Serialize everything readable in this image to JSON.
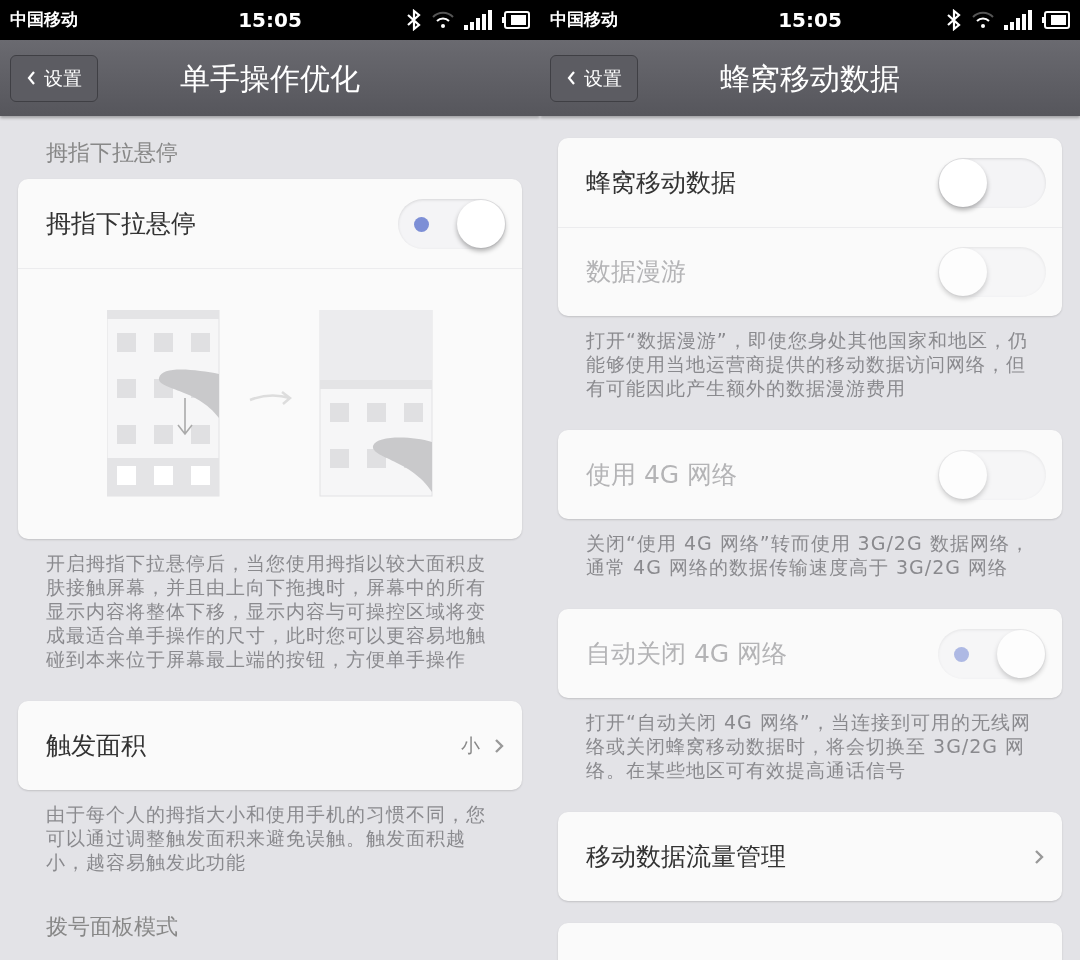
{
  "screens": [
    {
      "status_bar": {
        "carrier": "中国移动",
        "time": "15:05"
      },
      "nav": {
        "back": "设置",
        "title": "单手操作优化"
      },
      "items": [
        {
          "kind": "header",
          "text": "拇指下拉悬停"
        },
        {
          "kind": "card",
          "rows": [
            {
              "kind": "toggle",
              "label": "拇指下拉悬停",
              "on": true,
              "disabled": false
            },
            {
              "kind": "illustration"
            }
          ]
        },
        {
          "kind": "note",
          "text": "开启拇指下拉悬停后，当您使用拇指以较大面积皮肤接触屏幕，并且由上向下拖拽时，屏幕中的所有显示内容将整体下移，显示内容与可操控区域将变成最适合单手操作的尺寸，此时您可以更容易地触碰到本来位于屏幕最上端的按钮，方便单手操作"
        },
        {
          "kind": "card",
          "rows": [
            {
              "kind": "link",
              "label": "触发面积",
              "value": "小"
            }
          ]
        },
        {
          "kind": "note",
          "text": "由于每个人的拇指大小和使用手机的习惯不同，您可以通过调整触发面积来避免误触。触发面积越小，越容易触发此功能"
        },
        {
          "kind": "header",
          "text": "拨号面板模式"
        }
      ]
    },
    {
      "status_bar": {
        "carrier": "中国移动",
        "time": "15:05"
      },
      "nav": {
        "back": "设置",
        "title": "蜂窝移动数据"
      },
      "items": [
        {
          "kind": "card",
          "rows": [
            {
              "kind": "toggle",
              "label": "蜂窝移动数据",
              "on": false,
              "disabled": false
            },
            {
              "kind": "toggle",
              "label": "数据漫游",
              "on": false,
              "disabled": true
            }
          ]
        },
        {
          "kind": "note",
          "text": "打开“数据漫游”，即使您身处其他国家和地区，仍能够使用当地运营商提供的移动数据访问网络，但有可能因此产生额外的数据漫游费用"
        },
        {
          "kind": "card",
          "rows": [
            {
              "kind": "toggle",
              "label": "使用 4G 网络",
              "on": false,
              "disabled": true
            }
          ]
        },
        {
          "kind": "note",
          "text": "关闭“使用 4G 网络”转而使用 3G/2G 数据网络，通常 4G 网络的数据传输速度高于 3G/2G 网络"
        },
        {
          "kind": "card",
          "rows": [
            {
              "kind": "toggle",
              "label": "自动关闭 4G 网络",
              "on": true,
              "disabled": true
            }
          ]
        },
        {
          "kind": "note",
          "text": "打开“自动关闭 4G 网络”，当连接到可用的无线网络或关闭蜂窝移动数据时，将会切换至 3G/2G 网络。在某些地区可有效提高通话信号"
        },
        {
          "kind": "card",
          "rows": [
            {
              "kind": "link",
              "label": "移动数据流量管理"
            }
          ]
        },
        {
          "kind": "card"
        }
      ]
    }
  ]
}
